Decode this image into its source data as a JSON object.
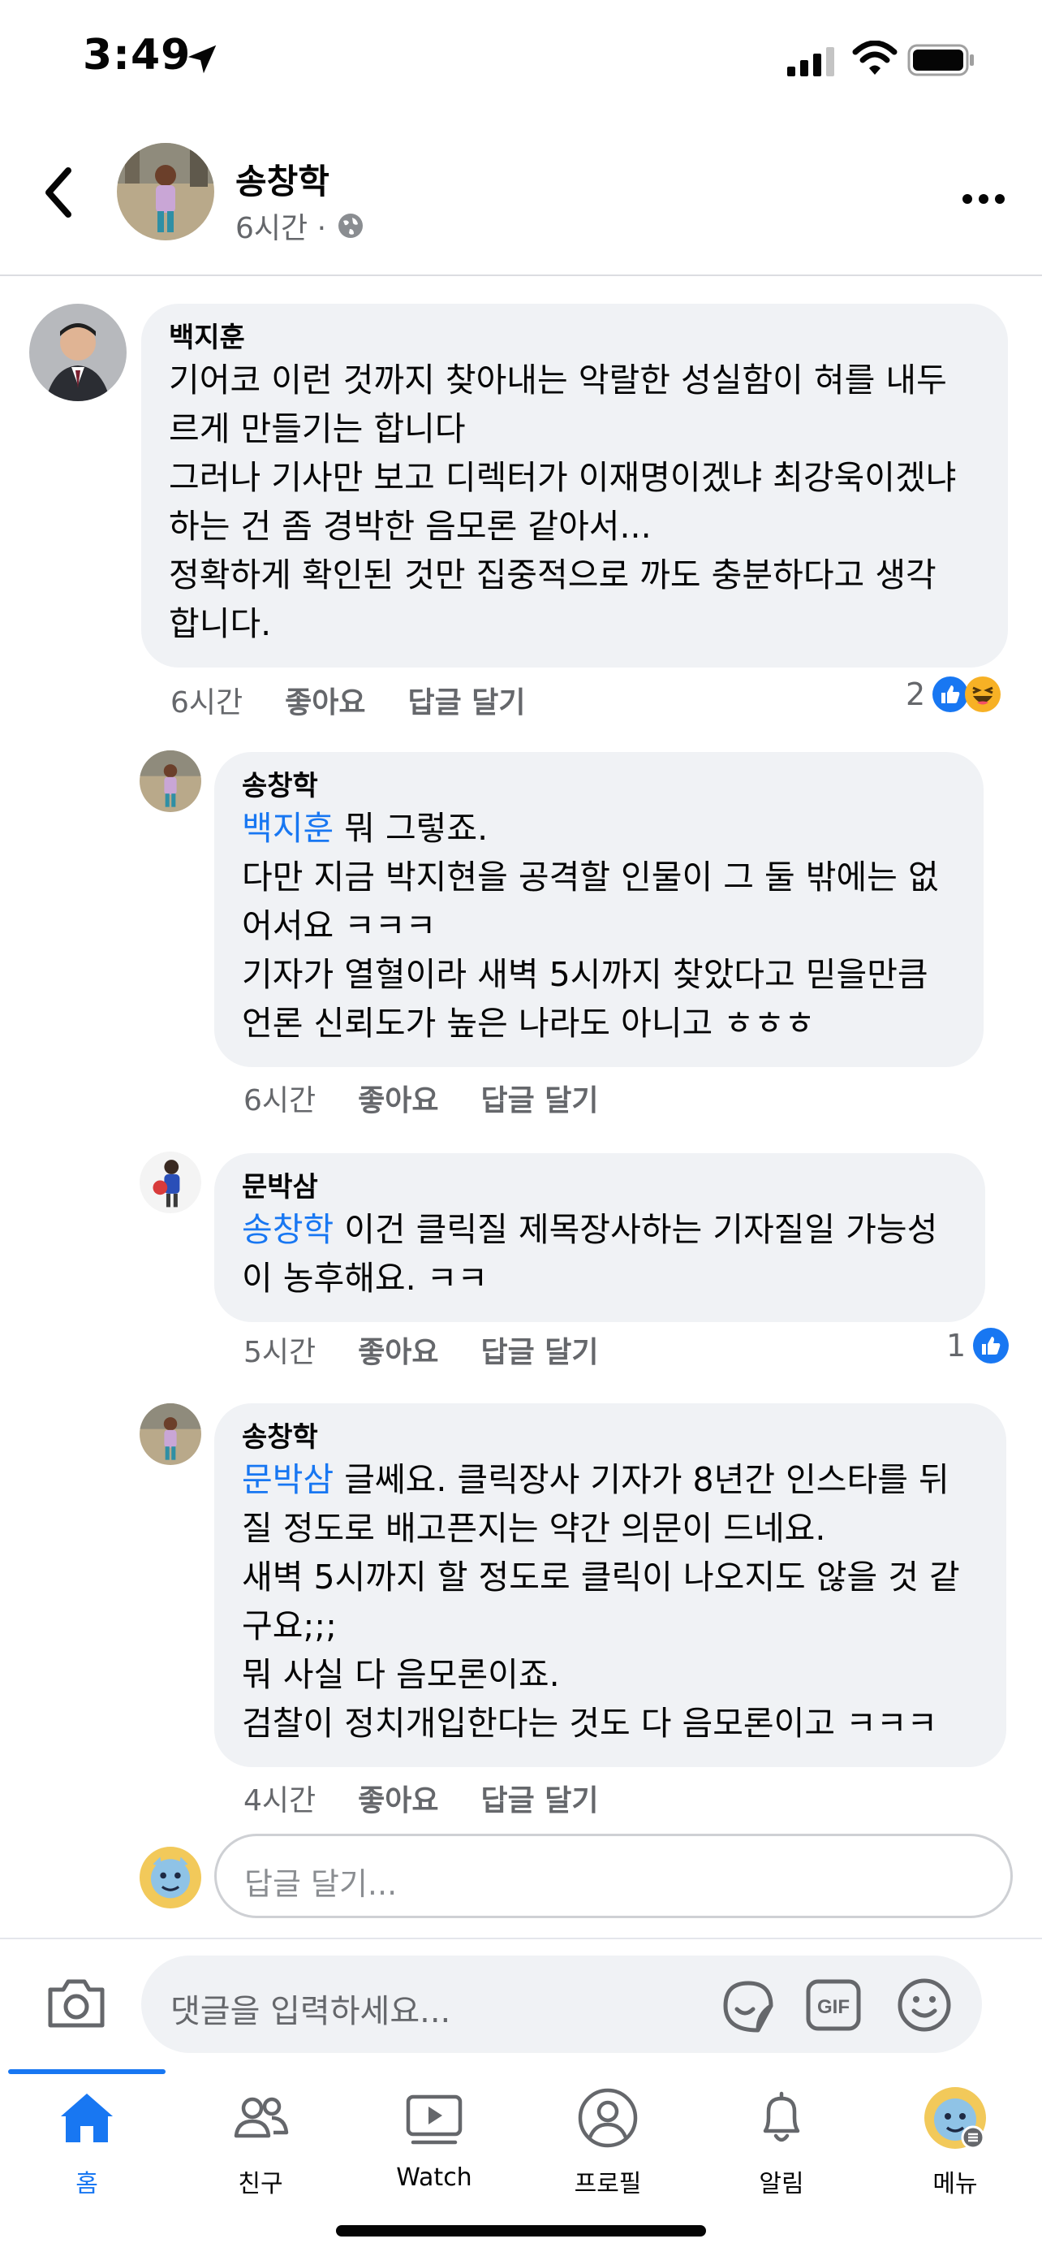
{
  "status": {
    "time": "3:49"
  },
  "post": {
    "author": "송창학",
    "time": "6시간 ·"
  },
  "comments": [
    {
      "author": "백지훈",
      "lines": [
        "기어코 이런 것까지 찾아내는 악랄한 성실함이 혀를 내두",
        "르게 만들기는 합니다",
        "그러나 기사만 보고 디렉터가 이재명이겠냐 최강욱이겠냐",
        "하는 건 좀 경박한 음모론 같아서...",
        "정확하게 확인된 것만 집중적으로 까도 충분하다고 생각",
        "합니다."
      ],
      "time": "6시간",
      "like": "좋아요",
      "reply": "답글 달기",
      "reaction_count": "2"
    },
    {
      "author": "송창학",
      "mention": "백지훈",
      "lines": [
        " 뭐 그렇죠.",
        "다만 지금 박지현을 공격할 인물이 그 둘 밖에는 없",
        "어서요 ㅋㅋㅋ",
        "기자가 열혈이라 새벽 5시까지 찾았다고 믿을만큼",
        "언론 신뢰도가 높은 나라도 아니고 ㅎㅎㅎ"
      ],
      "time": "6시간",
      "like": "좋아요",
      "reply": "답글 달기"
    },
    {
      "author": "문박삼",
      "mention": "송창학",
      "lines": [
        " 이건 클릭질 제목장사하는 기자질일 가능성",
        "이 농후해요. ㅋㅋ"
      ],
      "time": "5시간",
      "like": "좋아요",
      "reply": "답글 달기",
      "reaction_count": "1"
    },
    {
      "author": "송창학",
      "mention": "문박삼",
      "lines": [
        " 글쎄요. 클릭장사 기자가 8년간 인스타를 뒤",
        "질 정도로 배고픈지는 약간 의문이 드네요.",
        "새벽 5시까지 할 정도로 클릭이 나오지도 않을 것 같",
        "구요;;;",
        "뭐 사실 다 음모론이죠.",
        "검찰이 정치개입한다는 것도 다 음모론이고 ㅋㅋㅋ"
      ],
      "time": "4시간",
      "like": "좋아요",
      "reply": "답글 달기"
    }
  ],
  "reply_input": {
    "placeholder": "답글 달기..."
  },
  "composer": {
    "placeholder": "댓글을 입력하세요..."
  },
  "tabs": [
    {
      "label": "홈",
      "icon": "home-icon",
      "active": true
    },
    {
      "label": "친구",
      "icon": "friends-icon"
    },
    {
      "label": "Watch",
      "icon": "watch-icon"
    },
    {
      "label": "프로필",
      "icon": "profile-icon"
    },
    {
      "label": "알림",
      "icon": "bell-icon"
    },
    {
      "label": "메뉴",
      "icon": "menu-avatar-icon"
    }
  ],
  "colors": {
    "accent": "#1877f2",
    "bubble": "#f0f2f5",
    "secondary_text": "#65676b"
  }
}
